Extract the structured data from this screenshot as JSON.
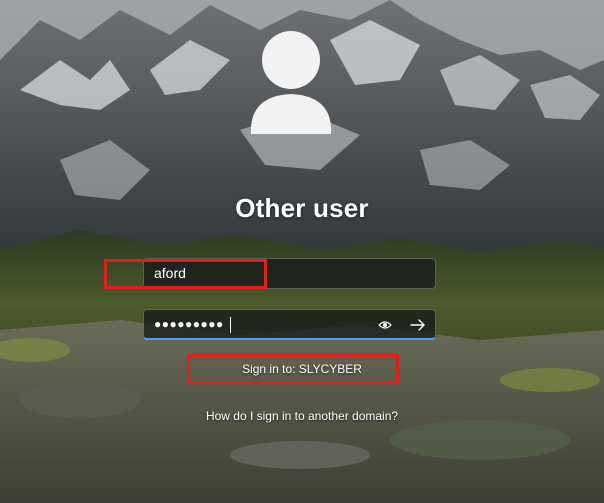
{
  "login": {
    "title": "Other user",
    "username_value": "aford",
    "password_mask": "●●●●●●●●●",
    "sign_in_to": "Sign in to: SLYCYBER",
    "other_domain_link": "How do I sign in to another domain?"
  },
  "icons": {
    "avatar": "user-avatar-icon",
    "reveal": "eye-icon",
    "submit": "arrow-right-icon"
  },
  "colors": {
    "focus_underline": "#4c9ff4",
    "annotation_box": "#e0201e"
  }
}
